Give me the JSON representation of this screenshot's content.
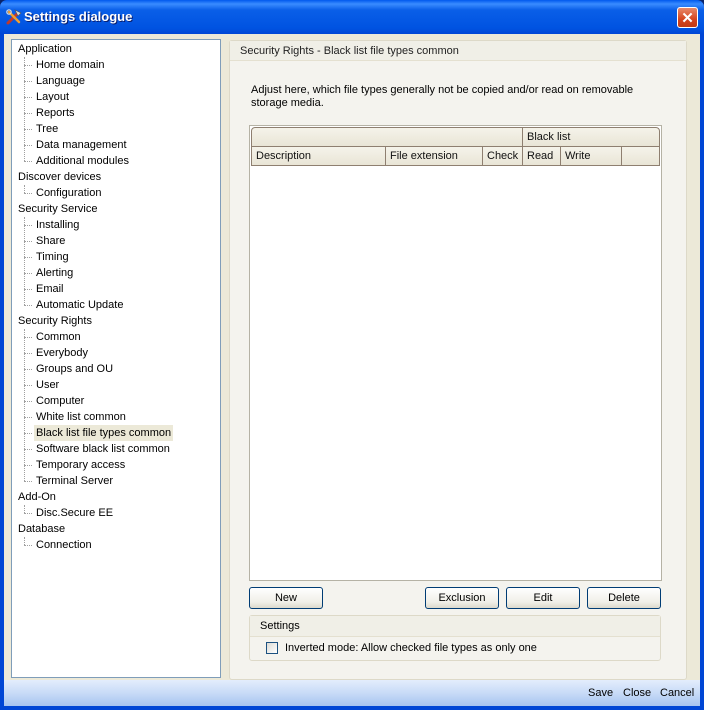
{
  "window": {
    "title": "Settings dialogue",
    "title_icon": "tools-icon",
    "close_glyph": "✕"
  },
  "tree": {
    "groups": [
      {
        "label": "Application",
        "children": [
          "Home domain",
          "Language",
          "Layout",
          "Reports",
          "Tree",
          "Data management",
          "Additional modules"
        ]
      },
      {
        "label": "Discover devices",
        "children": [
          "Configuration"
        ]
      },
      {
        "label": "Security Service",
        "children": [
          "Installing",
          "Share",
          "Timing",
          "Alerting",
          "Email",
          "Automatic Update"
        ]
      },
      {
        "label": "Security Rights",
        "children": [
          "Common",
          "Everybody",
          "Groups and OU",
          "User",
          "Computer",
          "White list common",
          "Black list file types common",
          "Software black list common",
          "Temporary access",
          "Terminal Server"
        ]
      },
      {
        "label": "Add-On",
        "children": [
          "Disc.Secure EE"
        ]
      },
      {
        "label": "Database",
        "children": [
          "Connection"
        ]
      }
    ],
    "selected": "Black list file types common"
  },
  "panel": {
    "header": "Security Rights - Black list file types common",
    "description": "Adjust here, which file types generally not be copied and/or read on removable storage media.",
    "grid": {
      "group_header": "Black list",
      "columns": [
        "Description",
        "File extension",
        "Check",
        "Read",
        "Write",
        ""
      ],
      "rows": []
    },
    "buttons": {
      "new": "New",
      "exclusion": "Exclusion",
      "edit": "Edit",
      "delete": "Delete"
    },
    "settings": {
      "header": "Settings",
      "inverted_mode_label": "Inverted mode: Allow checked file types as only one",
      "inverted_mode_checked": false
    }
  },
  "footer": {
    "save": "Save",
    "close": "Close",
    "cancel": "Cancel"
  }
}
